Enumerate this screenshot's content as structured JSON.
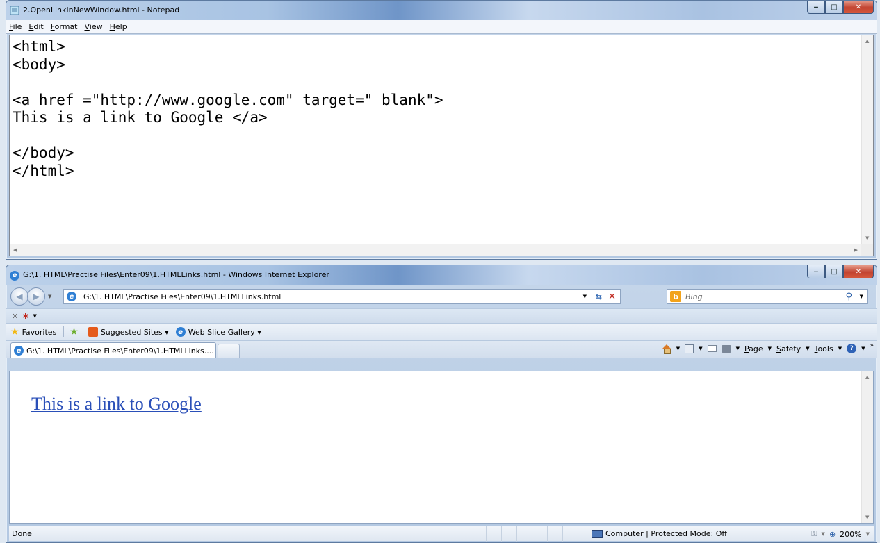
{
  "notepad": {
    "title": "2.OpenLinkInNewWindow.html - Notepad",
    "menu": [
      "File",
      "Edit",
      "Format",
      "View",
      "Help"
    ],
    "content": "<html>\n<body>\n\n<a href =\"http://www.google.com\" target=\"_blank\">\nThis is a link to Google </a>\n\n</body>\n</html>"
  },
  "ie": {
    "title": "G:\\1. HTML\\Practise Files\\Enter09\\1.HTMLLinks.html - Windows Internet Explorer",
    "address": "G:\\1. HTML\\Practise Files\\Enter09\\1.HTMLLinks.html",
    "search_placeholder": "Bing",
    "favorites": {
      "label": "Favorites",
      "suggested_sites": "Suggested Sites ▾",
      "web_slice_gallery": "Web Slice Gallery ▾"
    },
    "tab_title": "G:\\1. HTML\\Practise Files\\Enter09\\1.HTMLLinks....",
    "command_bar": {
      "page": "Page",
      "safety": "Safety",
      "tools": "Tools"
    },
    "page_link_text": "This is a link to Google",
    "status": {
      "text": "Done",
      "zone": "Computer | Protected Mode: Off",
      "zoom": "200%"
    }
  }
}
